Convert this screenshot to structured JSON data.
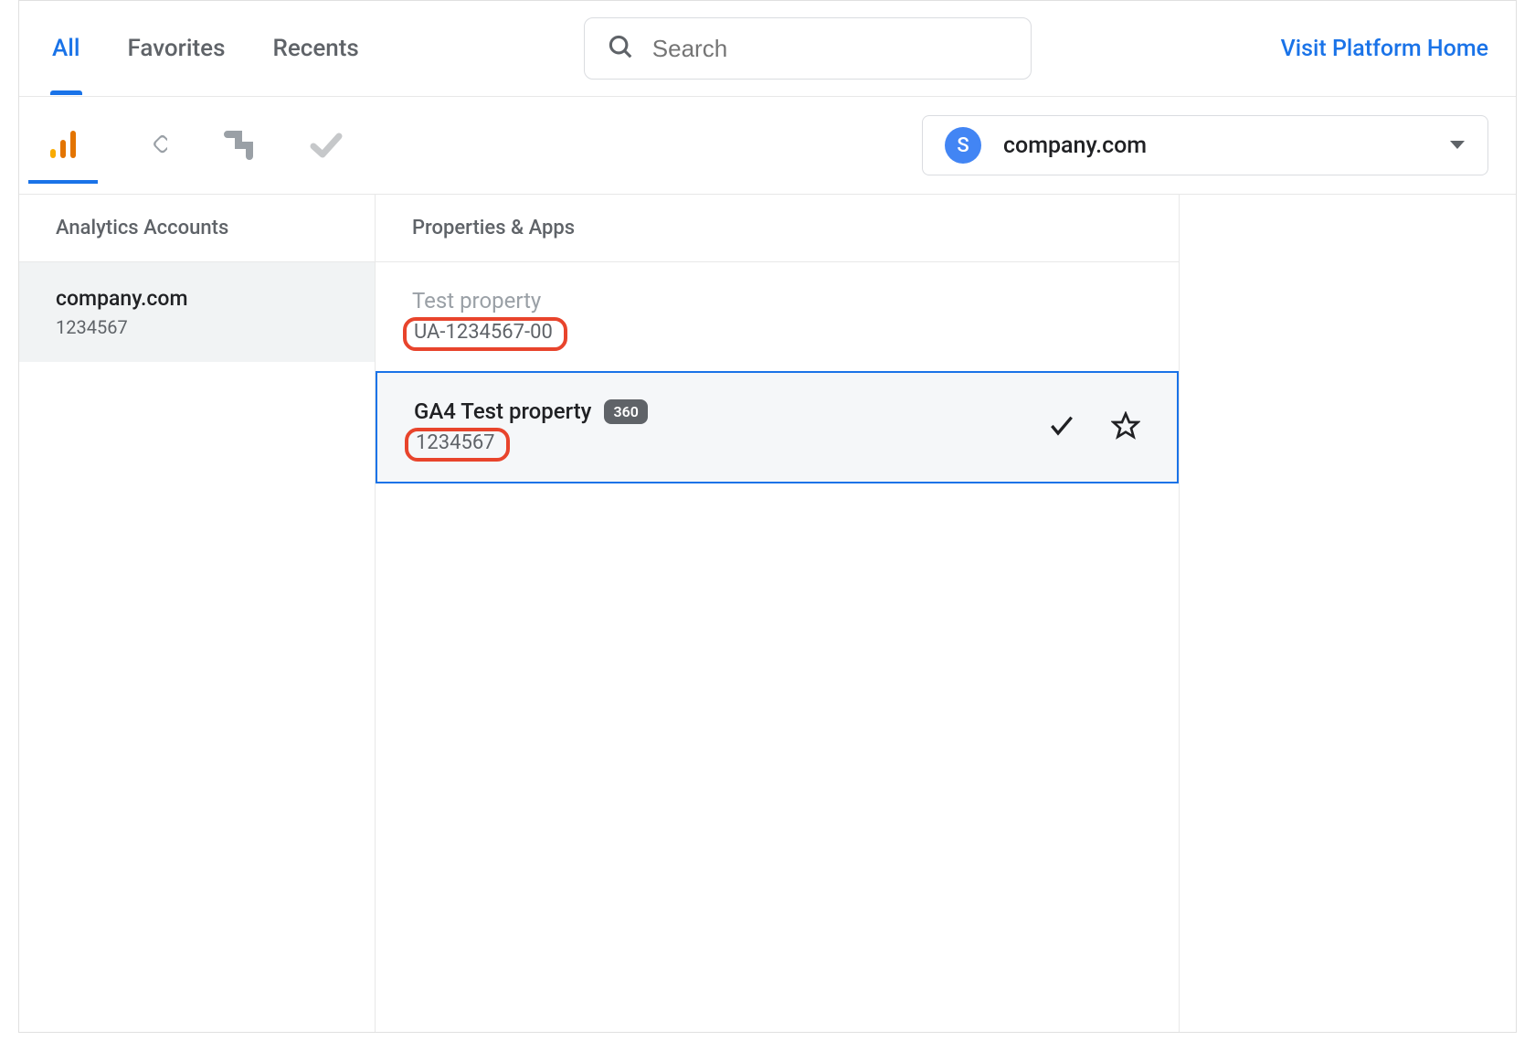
{
  "top_tabs": {
    "all": "All",
    "favorites": "Favorites",
    "recents": "Recents"
  },
  "search": {
    "placeholder": "Search"
  },
  "platform_link": "Visit Platform Home",
  "organization": {
    "avatar_letter": "S",
    "name": "company.com"
  },
  "columns": {
    "accounts_header": "Analytics Accounts",
    "properties_header": "Properties & Apps"
  },
  "account": {
    "name": "company.com",
    "id": "1234567"
  },
  "properties": [
    {
      "name": "Test property",
      "id": "UA-1234567-00",
      "selected": false,
      "badge": null
    },
    {
      "name": "GA4 Test property",
      "id": "1234567",
      "selected": true,
      "badge": "360"
    }
  ]
}
